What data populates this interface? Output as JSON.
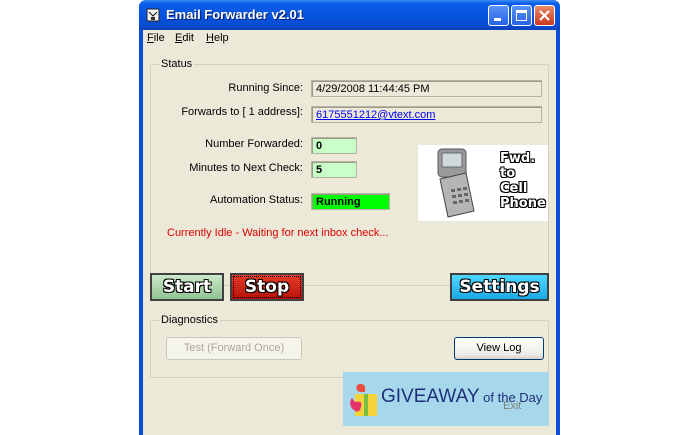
{
  "window": {
    "title": "Email Forwarder v2.01",
    "minimize_label": "minimize",
    "maximize_label": "maximize",
    "close_label": "close"
  },
  "menu": [
    {
      "label_first": "F",
      "label_rest": "ile"
    },
    {
      "label_first": "E",
      "label_rest": "dit"
    },
    {
      "label_first": "H",
      "label_rest": "elp"
    }
  ],
  "status": {
    "group_label": "Status",
    "running_since_label": "Running Since:",
    "running_since_value": "4/29/2008 11:44:45 PM",
    "forwards_to_label": "Forwards to [ 1 address]:",
    "forwards_to_value": "6175551212@vtext.com",
    "number_forwarded_label": "Number Forwarded:",
    "number_forwarded_value": "0",
    "minutes_label": "Minutes to Next Check:",
    "minutes_value": "5",
    "automation_label": "Automation Status:",
    "automation_value": "Running",
    "message": "Currently Idle - Waiting for next inbox check...",
    "phone_text_1": "Fwd.",
    "phone_text_2": "to",
    "phone_text_3": "Cell",
    "phone_text_4": "Phone"
  },
  "buttons": {
    "start": "Start",
    "stop": "Stop",
    "settings": "Settings"
  },
  "diagnostics": {
    "group_label": "Diagnostics",
    "test_button": "Test (Forward Once)",
    "view_log_button": "View Log"
  },
  "overlay": {
    "exit_label": "Exit",
    "giveaway_main": "GIVEAWAY",
    "giveaway_suffix": " of the Day"
  },
  "colors": {
    "titlebar": "#0654df",
    "window_bg": "#ece9d8",
    "status_message": "#e00000",
    "running_green": "#00ff00",
    "counter_green": "#c8ffc8",
    "stop_red": "#cc1e10",
    "settings_cyan": "#1aa9e6"
  }
}
